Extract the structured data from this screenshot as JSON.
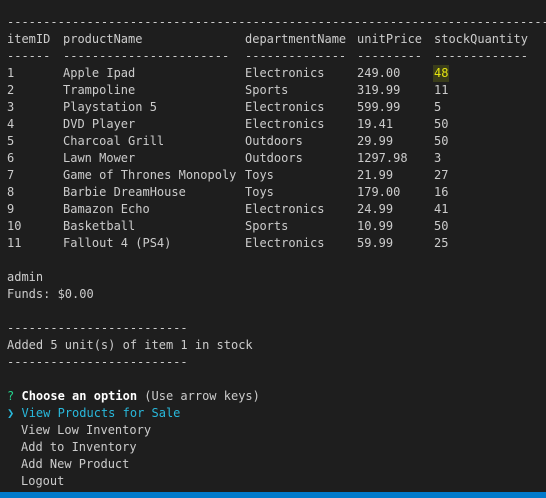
{
  "colors": {
    "background": "#1e1e1e",
    "text": "#cccccc",
    "highlight_text": "#e5e510",
    "prompt_question_mark": "#23d18b",
    "selected_option": "#29b8db",
    "status_bar": "#007acc"
  },
  "table": {
    "top_rule": "----------------------------------------------------------------------------",
    "headers": {
      "itemID": "itemID",
      "productName": "productName",
      "departmentName": "departmentName",
      "unitPrice": "unitPrice",
      "stockQuantity": "stockQuantity"
    },
    "separators": {
      "itemID": "------",
      "productName": "-----------------------",
      "departmentName": "--------------",
      "unitPrice": "---------",
      "stockQuantity": "-------------"
    },
    "rows": [
      {
        "id": "1",
        "name": "Apple Ipad",
        "dept": "Electronics",
        "price": "249.00",
        "qty": "48"
      },
      {
        "id": "2",
        "name": "Trampoline",
        "dept": "Sports",
        "price": "319.99",
        "qty": "11"
      },
      {
        "id": "3",
        "name": "Playstation 5",
        "dept": "Electronics",
        "price": "599.99",
        "qty": "5"
      },
      {
        "id": "4",
        "name": "DVD Player",
        "dept": "Electronics",
        "price": "19.41",
        "qty": "50"
      },
      {
        "id": "5",
        "name": "Charcoal Grill",
        "dept": "Outdoors",
        "price": "29.99",
        "qty": "50"
      },
      {
        "id": "6",
        "name": "Lawn Mower",
        "dept": "Outdoors",
        "price": "1297.98",
        "qty": "3"
      },
      {
        "id": "7",
        "name": "Game of Thrones Monopoly",
        "dept": "Toys",
        "price": "21.99",
        "qty": "27"
      },
      {
        "id": "8",
        "name": "Barbie DreamHouse",
        "dept": "Toys",
        "price": "179.00",
        "qty": "16"
      },
      {
        "id": "9",
        "name": "Bamazon Echo",
        "dept": "Electronics",
        "price": "24.99",
        "qty": "41"
      },
      {
        "id": "10",
        "name": "Basketball",
        "dept": "Sports",
        "price": "10.99",
        "qty": "50"
      },
      {
        "id": "11",
        "name": "Fallout 4 (PS4)",
        "dept": "Electronics",
        "price": "59.99",
        "qty": "25"
      }
    ]
  },
  "user": {
    "name": "admin",
    "funds": "Funds: $0.00"
  },
  "message": {
    "rule_top": "-------------------------",
    "text": "Added 5 unit(s) of item 1 in stock",
    "rule_bottom": "-------------------------"
  },
  "prompt": {
    "question_mark": "?",
    "title": "Choose an option",
    "hint": " (Use arrow keys)",
    "pointer": "❯",
    "options": [
      "View Products for Sale",
      "View Low Inventory",
      "Add to Inventory",
      "Add New Product",
      "Logout"
    ]
  }
}
